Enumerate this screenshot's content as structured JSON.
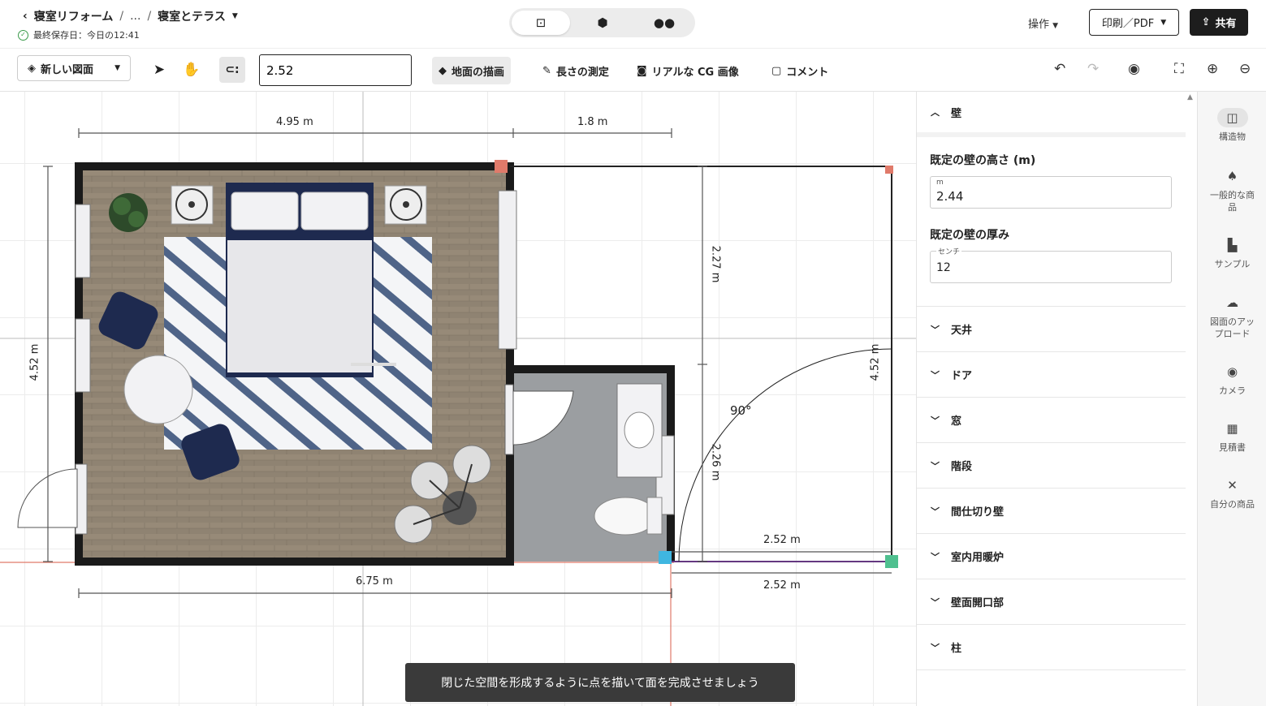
{
  "header": {
    "back_label": "寝室リフォーム",
    "ellipsis": "...",
    "sep1": "/",
    "sep2": "/",
    "current": "寝室とテラス",
    "saved": "最終保存日：今日の12:41",
    "view_modes": [
      {
        "name": "2d-plan-icon",
        "glyph": "⊡"
      },
      {
        "name": "3d-cube-icon",
        "glyph": "⬢"
      },
      {
        "name": "walk-icon",
        "glyph": "👣"
      }
    ],
    "ops_label": "操作",
    "print_label": "印刷／PDF",
    "share_label": "共有"
  },
  "toolbar": {
    "new_plan": "新しい図面",
    "value": "2.52",
    "draw_floor": "地面の描画",
    "measure": "長さの測定",
    "render": "リアルな CG 画像",
    "comment": "コメント"
  },
  "dimensions": {
    "top_left": "4.95 m",
    "top_right": "1.8 m",
    "left": "4.52 m",
    "bottom": "6.75 m",
    "inner_upper": "2.27 m",
    "inner_lower": "2.26 m",
    "right": "4.52 m",
    "terrace_top": "2.52 m",
    "terrace_bottom": "2.52 m",
    "angle": "90°"
  },
  "toast": "閉じた空間を形成するように点を描いて面を完成させましょう",
  "panel": {
    "wall_section": "壁",
    "height_title": "既定の壁の高さ (m)",
    "height_unit": "m",
    "height_value": "2.44",
    "thickness_title": "既定の壁の厚み",
    "thickness_unit": "センチ",
    "thickness_value": "12",
    "sections": [
      "天井",
      "ドア",
      "窓",
      "階段",
      "間仕切り壁",
      "室内用暖炉",
      "壁面開口部",
      "柱"
    ]
  },
  "rail": [
    {
      "label": "構造物",
      "icon": "structure-icon",
      "glyph": "◫"
    },
    {
      "label": "一般的な商品",
      "icon": "furniture-icon",
      "glyph": "♠"
    },
    {
      "label": "サンプル",
      "icon": "sample-icon",
      "glyph": "▙"
    },
    {
      "label": "図面のアップロード",
      "icon": "upload-icon",
      "glyph": "☁"
    },
    {
      "label": "カメラ",
      "icon": "camera-icon",
      "glyph": "◉"
    },
    {
      "label": "見積書",
      "icon": "estimate-icon",
      "glyph": "▦"
    },
    {
      "label": "自分の商品",
      "icon": "my-products-icon",
      "glyph": "✕"
    }
  ],
  "colors": {
    "wall": "#1a1a1a",
    "wood_floor": "#8f8372",
    "bath_floor": "#9b9ea1",
    "rug_stripe": "#4f6488",
    "navy": "#1e2a4f",
    "accent_red": "#e07a6a",
    "accent_blue": "#3fb6e0",
    "accent_green": "#4fc08f"
  }
}
